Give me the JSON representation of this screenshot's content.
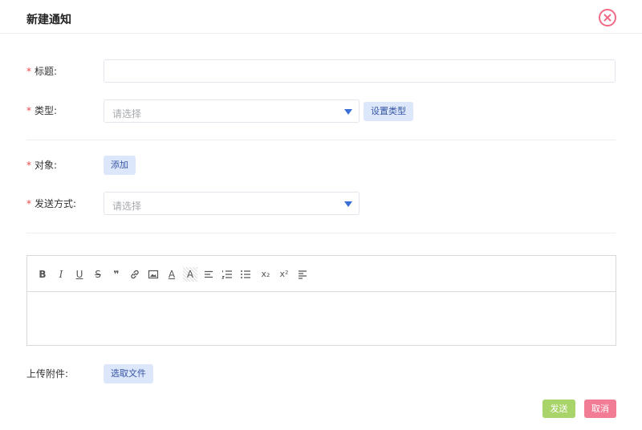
{
  "dialog": {
    "title": "新建通知",
    "close_icon": "close-circle-icon"
  },
  "form": {
    "required_mark": "*",
    "title_label": "标题:",
    "title_value": "",
    "type_label": "类型:",
    "type_placeholder": "请选择",
    "set_type_button": "设置类型",
    "target_label": "对象:",
    "add_button": "添加",
    "send_method_label": "发送方式:",
    "send_method_placeholder": "请选择",
    "attachment_label": "上传附件:",
    "choose_file_button": "选取文件"
  },
  "editor": {
    "tools": [
      {
        "name": "bold-icon",
        "glyph": "B"
      },
      {
        "name": "italic-icon",
        "glyph": "I"
      },
      {
        "name": "underline-icon",
        "glyph": "U"
      },
      {
        "name": "strikethrough-icon",
        "glyph": "S"
      },
      {
        "name": "blockquote-icon",
        "glyph": "❞"
      },
      {
        "name": "link-icon",
        "glyph": ""
      },
      {
        "name": "image-icon",
        "glyph": ""
      },
      {
        "name": "font-color-icon",
        "glyph": "A"
      },
      {
        "name": "background-color-icon",
        "glyph": "A"
      },
      {
        "name": "align-left-icon",
        "glyph": ""
      },
      {
        "name": "ordered-list-icon",
        "glyph": ""
      },
      {
        "name": "bullet-list-icon",
        "glyph": ""
      },
      {
        "name": "subscript-icon",
        "glyph": "x₂"
      },
      {
        "name": "superscript-icon",
        "glyph": "x²"
      },
      {
        "name": "align-icon",
        "glyph": ""
      }
    ],
    "content": ""
  },
  "actions": {
    "send": "发送",
    "cancel": "取消"
  },
  "colors": {
    "required": "#e8484b",
    "send_button": "#a8d46a",
    "cancel_button": "#f37c95",
    "light_button": "#dde7fb",
    "close_icon": "#f06a86"
  }
}
